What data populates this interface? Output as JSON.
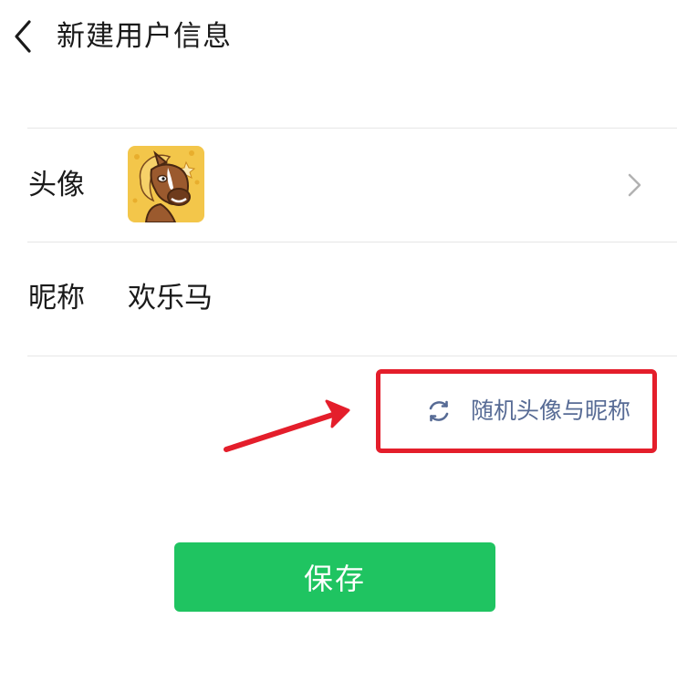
{
  "header": {
    "title": "新建用户信息",
    "back_icon": "chevron-left-icon"
  },
  "profile": {
    "avatar_label": "头像",
    "avatar_icon": "horse-avatar",
    "avatar_chevron_icon": "chevron-right-icon",
    "nickname_label": "昵称",
    "nickname_value": "欢乐马"
  },
  "random": {
    "icon": "refresh-icon",
    "label": "随机头像与昵称"
  },
  "save": {
    "label": "保存"
  },
  "colors": {
    "link": "#576b95",
    "button": "#1fc461",
    "annotation": "#e41e2b",
    "divider": "#e6e6e6"
  }
}
